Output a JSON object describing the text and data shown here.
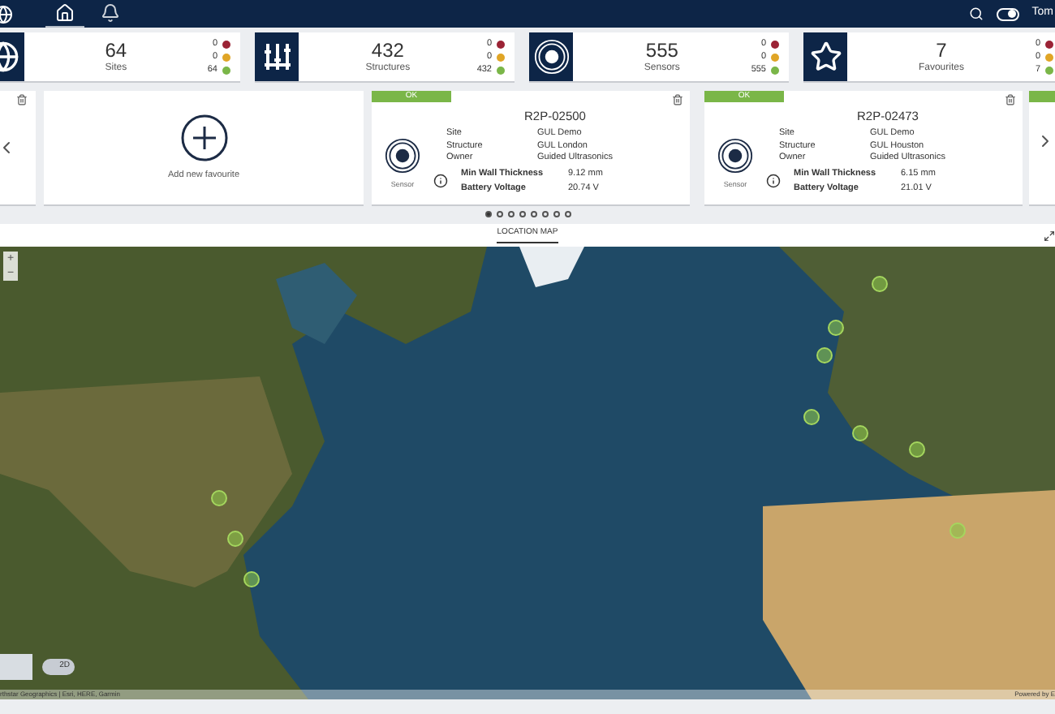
{
  "header": {
    "nav": [
      {
        "kind": "home",
        "selected": true
      },
      {
        "kind": "bell",
        "selected": false
      }
    ],
    "theme_toggle": {
      "on": true
    },
    "user": "Tom"
  },
  "stats": [
    {
      "kind": "globe",
      "value": "64",
      "label": "Sites",
      "counts": [
        {
          "value": "0",
          "color": "#9b2335"
        },
        {
          "value": "0",
          "color": "#e0a526"
        },
        {
          "value": "64",
          "color": "#7ab648"
        }
      ]
    },
    {
      "kind": "structure",
      "value": "432",
      "label": "Structures",
      "counts": [
        {
          "value": "0",
          "color": "#9b2335"
        },
        {
          "value": "0",
          "color": "#e0a526"
        },
        {
          "value": "432",
          "color": "#7ab648"
        }
      ]
    },
    {
      "kind": "sensor",
      "value": "555",
      "label": "Sensors",
      "counts": [
        {
          "value": "0",
          "color": "#9b2335"
        },
        {
          "value": "0",
          "color": "#e0a526"
        },
        {
          "value": "555",
          "color": "#7ab648"
        }
      ]
    },
    {
      "kind": "star",
      "value": "7",
      "label": "Favourites",
      "counts": [
        {
          "value": "0",
          "color": "#9b2335"
        },
        {
          "value": "0",
          "color": "#e0a526"
        },
        {
          "value": "7",
          "color": "#7ab648"
        }
      ]
    }
  ],
  "favourites": {
    "add_label": "Add new favourite",
    "cards": [
      {
        "status": "OK",
        "color": "#7ab648",
        "id": "R2P-02500",
        "device": "Sensor",
        "fields": [
          {
            "label": "Site",
            "value": "GUL Demo"
          },
          {
            "label": "Structure",
            "value": "GUL London"
          },
          {
            "label": "Owner",
            "value": "Guided Ultrasonics"
          }
        ],
        "readings": [
          {
            "label": "Min Wall Thickness",
            "value": "9.12 mm"
          },
          {
            "label": "Battery Voltage",
            "value": "20.74 V"
          }
        ]
      },
      {
        "status": "OK",
        "color": "#7ab648",
        "id": "R2P-02473",
        "device": "Sensor",
        "fields": [
          {
            "label": "Site",
            "value": "GUL Demo"
          },
          {
            "label": "Structure",
            "value": "GUL Houston"
          },
          {
            "label": "Owner",
            "value": "Guided Ultrasonics"
          }
        ],
        "readings": [
          {
            "label": "Min Wall Thickness",
            "value": "6.15 mm"
          },
          {
            "label": "Battery Voltage",
            "value": "21.01 V"
          }
        ]
      }
    ],
    "pages": [
      {
        "selected": true
      },
      {
        "selected": false
      },
      {
        "selected": false
      },
      {
        "selected": false
      },
      {
        "selected": false
      },
      {
        "selected": false
      },
      {
        "selected": false
      },
      {
        "selected": false
      }
    ]
  },
  "map": {
    "tab": "LOCATION MAP",
    "zoom_in": "+",
    "zoom_out": "−",
    "view_mode": "2D",
    "attribution": "rthstar Geographics | Esri, HERE, Garmin",
    "powered_by": "Powered by E"
  }
}
